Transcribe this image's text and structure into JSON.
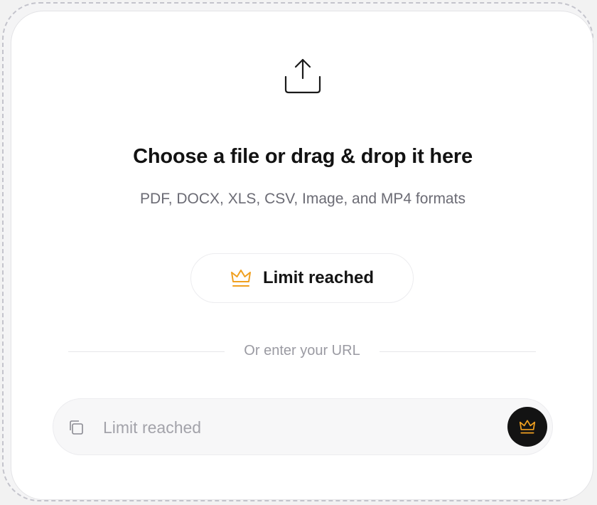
{
  "upload": {
    "icon": "upload-icon",
    "title": "Choose a file or drag & drop it here",
    "formats": "PDF, DOCX, XLS, CSV, Image, and MP4 formats"
  },
  "limit_button": {
    "icon": "crown-icon",
    "label": "Limit reached"
  },
  "divider": {
    "text": "Or enter your URL"
  },
  "url_bar": {
    "icon": "copy-icon",
    "placeholder": "Limit reached",
    "value": "",
    "submit_icon": "crown-icon"
  },
  "colors": {
    "crown_accent": "#f0a020",
    "submit_bg": "#131313",
    "title_text": "#121212",
    "muted_text": "#6b6b74"
  }
}
